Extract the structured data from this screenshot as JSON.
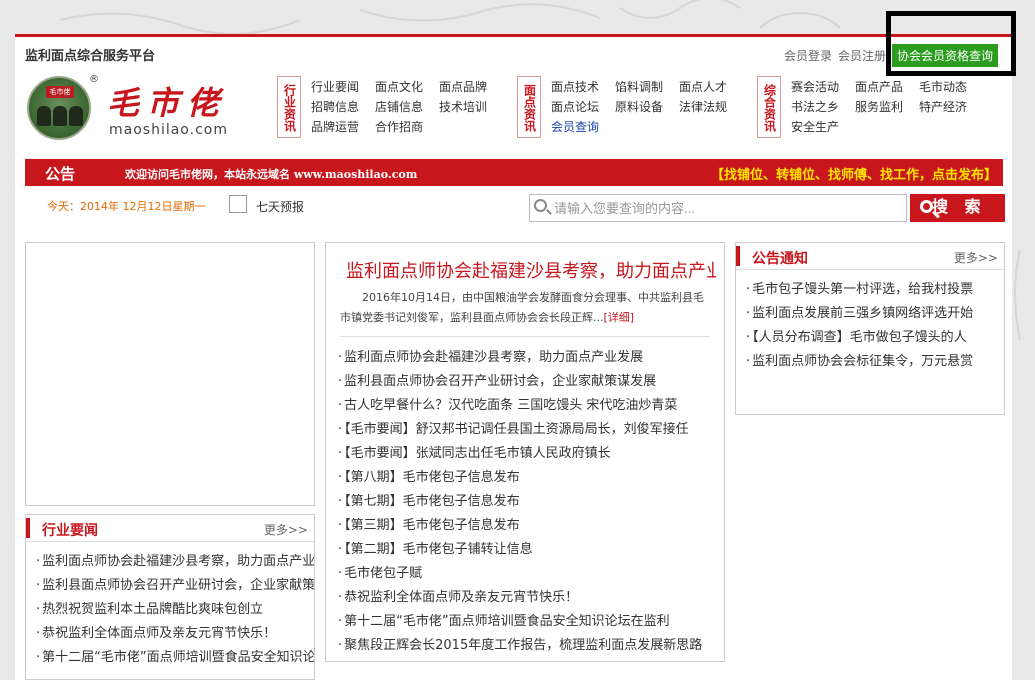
{
  "topbar": {
    "site_title": "监利面点综合服务平台",
    "login": "会员登录",
    "register": "会员注册",
    "query_button": "协会会员资格查询"
  },
  "logo": {
    "seal_text": "毛市佬",
    "registered": "®",
    "brand": "毛市佬",
    "url": "maoshilao.com"
  },
  "nav": [
    {
      "tag": [
        "行",
        "业",
        "资",
        "讯"
      ],
      "links": [
        "行业要闻",
        "面点文化",
        "面点品牌",
        "招聘信息",
        "店铺信息",
        "技术培训",
        "品牌运营",
        "合作招商"
      ]
    },
    {
      "tag": [
        "面",
        "点",
        "资",
        "讯"
      ],
      "links": [
        "面点技术",
        "馅料调制",
        "面点人才",
        "面点论坛",
        "原料设备",
        "法律法规",
        "会员查询"
      ]
    },
    {
      "tag": [
        "综",
        "合",
        "资",
        "讯"
      ],
      "links": [
        "赛会活动",
        "面点产品",
        "毛市动态",
        "书法之乡",
        "服务监利",
        "特产经济",
        "安全生产"
      ]
    }
  ],
  "notice": {
    "title": "公告",
    "text": "欢迎访问毛市佬网，本站永远域名 www.maoshilao.com",
    "right": "【找铺位、转铺位、找师傅、找工作，点击发布】"
  },
  "datebar": {
    "today": "今天：2014年 12月12日星期一",
    "forecast": "七天预报"
  },
  "search": {
    "placeholder": "请输入您要查询的内容...",
    "button": "搜 索"
  },
  "industry": {
    "title": "行业要闻",
    "more": "更多>>",
    "items": [
      "监利面点师协会赴福建沙县考察，助力面点产业发展",
      "监利县面点师协会召开产业研讨会，企业家献策谋发展",
      "热烈祝贺监利本土品牌酷比爽味包创立",
      "恭祝监利全体面点师及亲友元宵节快乐！",
      "第十二届“毛市佬”面点师培训暨食品安全知识论坛"
    ]
  },
  "center": {
    "headline": "监利面点师协会赴福建沙县考察，助力面点产业发展",
    "summary": "2016年10月14日，由中国粮油学会发酵面食分会理事、中共监利县毛市镇党委书记刘俊军，监利县面点师协会会长段正辉...",
    "detail": "[详细]",
    "items": [
      "监利面点师协会赴福建沙县考察，助力面点产业发展",
      "监利县面点师协会召开产业研讨会，企业家献策谋发展",
      "古人吃早餐什么？汉代吃面条 三国吃馒头 宋代吃油炒青菜",
      "【毛市要闻】舒汉邦书记调任县国土资源局局长，刘俊军接任",
      "【毛市要闻】张斌同志出任毛市镇人民政府镇长",
      "【第八期】毛市佬包子信息发布",
      "【第七期】毛市佬包子信息发布",
      "【第三期】毛市佬包子信息发布",
      "【第二期】毛市佬包子铺转让信息",
      "毛市佬包子赋",
      "恭祝监利全体面点师及亲友元宵节快乐！",
      "第十二届“毛市佬”面点师培训暨食品安全知识论坛在监利",
      "聚焦段正辉会长2015年度工作报告，梳理监利面点发展新思路"
    ]
  },
  "notices": {
    "title": "公告通知",
    "more": "更多>>",
    "items": [
      "毛市包子馒头第一村评选，给我村投票",
      "监利面点发展前三强乡镇网络评选开始",
      "【人员分布调查】毛市做包子馒头的人",
      "监利面点师协会会标征集令，万元悬赏"
    ]
  },
  "colors": {
    "brand_red": "#c8161d",
    "query_green": "#2a9d1e",
    "notice_yellow": "#ffe600",
    "date_orange": "#e26a00",
    "link_blue": "#1a4aa8"
  }
}
